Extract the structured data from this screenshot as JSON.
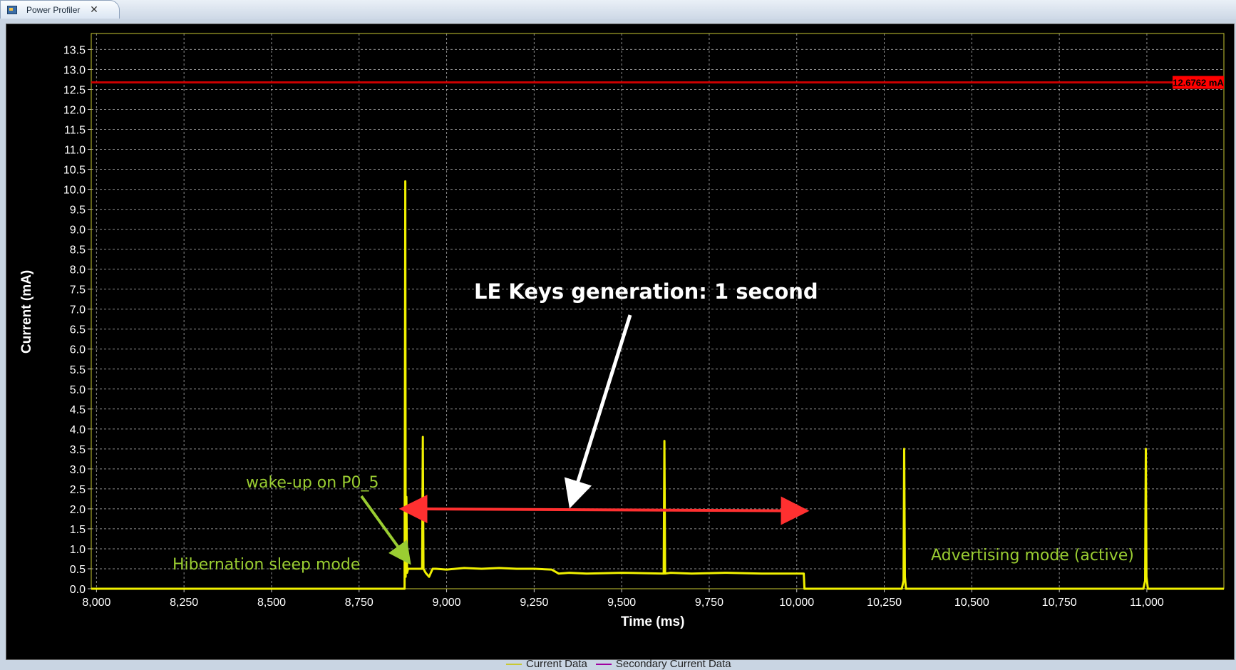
{
  "window": {
    "tab_title": "Power Profiler",
    "tab_icon": "app-window-icon",
    "close_icon": "close-icon"
  },
  "colors": {
    "background": "#000000",
    "grid": "#c8c8c8",
    "plot_border": "#c8c832",
    "series_current": "#f0f000",
    "series_secondary": "#a000a0",
    "threshold": "#cc0000",
    "annotation_green": "#9acd32",
    "annotation_arrow_red": "#ff3030"
  },
  "chart_data": {
    "type": "line",
    "xlabel": "Time (ms)",
    "ylabel": "Current (mA)",
    "xlim": [
      7985,
      11220
    ],
    "ylim": [
      0,
      13.9
    ],
    "x_ticks": [
      8000,
      8250,
      8500,
      8750,
      9000,
      9250,
      9500,
      9750,
      10000,
      10250,
      10500,
      10750,
      11000
    ],
    "x_tick_labels": [
      "8,000",
      "8,250",
      "8,500",
      "8,750",
      "9,000",
      "9,250",
      "9,500",
      "9,750",
      "10,000",
      "10,250",
      "10,500",
      "10,750",
      "11,000"
    ],
    "y_ticks": [
      0.0,
      0.5,
      1.0,
      1.5,
      2.0,
      2.5,
      3.0,
      3.5,
      4.0,
      4.5,
      5.0,
      5.5,
      6.0,
      6.5,
      7.0,
      7.5,
      8.0,
      8.5,
      9.0,
      9.5,
      10.0,
      10.5,
      11.0,
      11.5,
      12.0,
      12.5,
      13.0,
      13.5
    ],
    "y_tick_labels": [
      "0.0",
      "0.5",
      "1.0",
      "1.5",
      "2.0",
      "2.5",
      "3.0",
      "3.5",
      "4.0",
      "4.5",
      "5.0",
      "5.5",
      "6.0",
      "6.5",
      "7.0",
      "7.5",
      "8.0",
      "8.5",
      "9.0",
      "9.5",
      "10.0",
      "10.5",
      "11.0",
      "11.5",
      "12.0",
      "12.5",
      "13.0",
      "13.5"
    ],
    "grid": true,
    "threshold": {
      "value": 12.6762,
      "label": "12.6762 mA"
    },
    "legend": {
      "placement": "bottom-center",
      "entries": [
        "Current Data",
        "Secondary Current Data"
      ]
    },
    "series": [
      {
        "name": "Current Data",
        "x": [
          7985,
          8880,
          8882,
          8883,
          8885,
          8887,
          8890,
          8900,
          8930,
          8932,
          8934,
          8940,
          8950,
          8960,
          8970,
          9000,
          9050,
          9100,
          9150,
          9200,
          9250,
          9300,
          9320,
          9350,
          9400,
          9500,
          9620,
          9622,
          9624,
          9640,
          9700,
          9800,
          9900,
          10020,
          10022,
          10030,
          10300,
          10305,
          10307,
          10309,
          10312,
          10320,
          10600,
          10990,
          10995,
          10997,
          10999,
          11003,
          11010,
          11220
        ],
        "y": [
          0.0,
          0.0,
          10.2,
          0.3,
          2.3,
          0.4,
          0.5,
          0.5,
          0.5,
          3.8,
          0.5,
          0.4,
          0.3,
          0.5,
          0.5,
          0.48,
          0.52,
          0.5,
          0.52,
          0.5,
          0.5,
          0.48,
          0.38,
          0.4,
          0.38,
          0.4,
          0.38,
          3.7,
          0.38,
          0.4,
          0.38,
          0.4,
          0.38,
          0.38,
          0.0,
          0.0,
          0.0,
          0.2,
          3.5,
          0.3,
          0.0,
          0.0,
          0.0,
          0.0,
          0.2,
          3.5,
          0.3,
          0.0,
          0.0,
          0.0
        ]
      },
      {
        "name": "Secondary Current Data",
        "x": [],
        "y": []
      }
    ],
    "annotations": [
      {
        "text": "LE Keys generation: 1 second"
      },
      {
        "text": "wake-up on P0_5"
      },
      {
        "text": "Hibernation sleep mode"
      },
      {
        "text": "Advertising mode (active)"
      }
    ]
  }
}
